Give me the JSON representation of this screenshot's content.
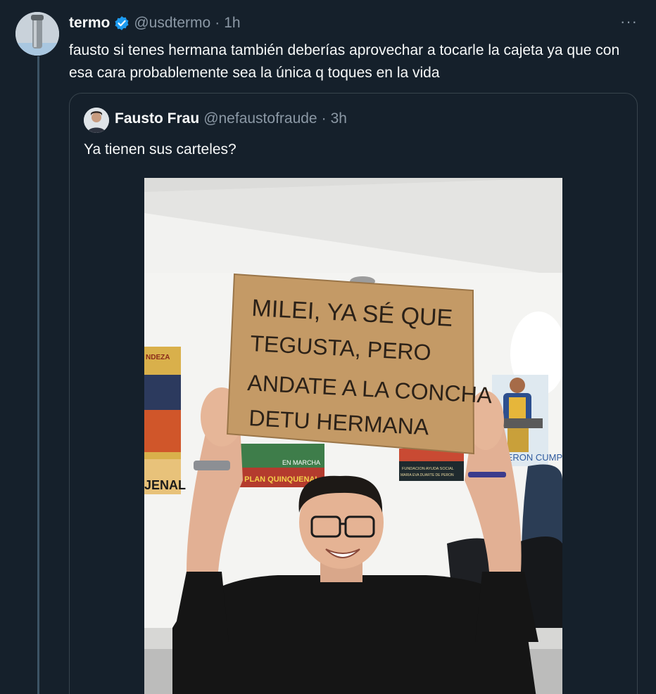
{
  "tweet": {
    "author_name": "termo",
    "handle": "@usdtermo",
    "separator": "·",
    "time": "1h",
    "more_label": "···",
    "text": "fausto si tenes hermana también deberías aprovechar a tocarle la cajeta ya que con esa cara probablemente sea la única q toques en la vida"
  },
  "quote": {
    "author_name": "Fausto Frau",
    "handle": "@nefaustofraude",
    "separator": "·",
    "time": "3h",
    "text": "Ya tienen sus carteles?"
  },
  "photo": {
    "sign_lines": [
      "MILEI, YA SÉ QUE",
      "TEGUSTA, PERO",
      "ANDATE A LA CONCHA",
      "DETU HERMANA"
    ],
    "poster_left_top": "NDEZA",
    "poster_left_bottom": "JENAL",
    "poster_center_left_top": "EN MARCHA",
    "poster_center_left_bottom": "2 PLAN QUINQUENAL",
    "poster_center_right_top": "FUNDACION AYUDA SOCIAL",
    "poster_center_right_bottom": "MARIA EVA DUARTE DE PERON",
    "poster_right_bottom": "PERON CUMPLE"
  },
  "colors": {
    "background": "#15202b",
    "verified": "#1d9bf0",
    "secondary_text": "#8b98a5",
    "border": "#38444d"
  },
  "icons": [
    "verified-badge-icon",
    "more-options-icon"
  ]
}
